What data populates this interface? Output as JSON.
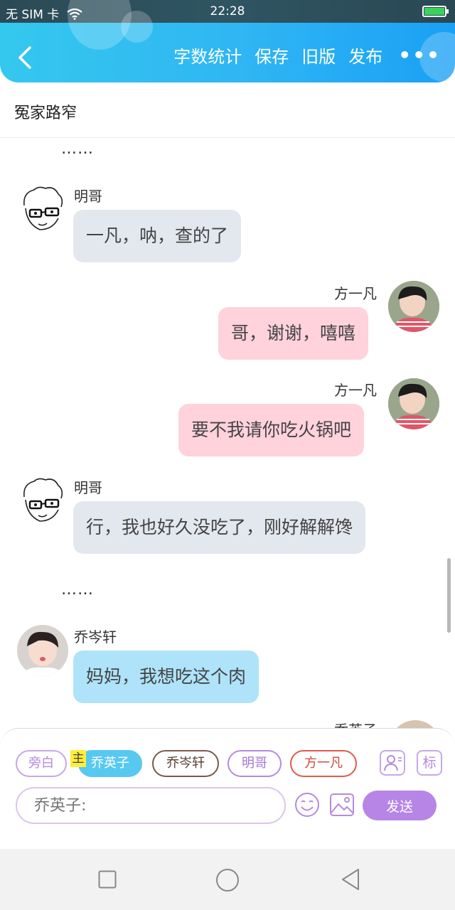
{
  "status_bar": {
    "carrier": "无 SIM 卡",
    "time": "22:28"
  },
  "header": {
    "actions": [
      "字数统计",
      "保存",
      "旧版",
      "发布"
    ],
    "more": "•••"
  },
  "title": "冤家路窄",
  "messages": [
    {
      "type": "ellipsis",
      "text": "……"
    },
    {
      "name": "明哥",
      "text": "一凡，呐，查的了",
      "side": "left",
      "color": "gray"
    },
    {
      "name": "方一凡",
      "text": "哥，谢谢，嘻嘻",
      "side": "right",
      "color": "pink"
    },
    {
      "name": "方一凡",
      "text": "要不我请你吃火锅吧",
      "side": "right",
      "color": "pink"
    },
    {
      "name": "明哥",
      "text": "行，我也好久没吃了，刚好解解馋",
      "side": "left",
      "color": "gray"
    },
    {
      "type": "ellipsis",
      "text": "……"
    },
    {
      "name": "乔岑轩",
      "text": "妈妈，我想吃这个肉",
      "side": "left",
      "color": "blue"
    },
    {
      "name": "乔英子",
      "side": "right",
      "partial": true
    }
  ],
  "characters": [
    {
      "label": "旁白",
      "color": "#c7a8e8",
      "text_color": "#b68ae0"
    },
    {
      "label": "乔英子",
      "active": true
    },
    {
      "label": "乔岑轩",
      "color": "#7a5a4a",
      "text_color": "#5a4034"
    },
    {
      "label": "明哥",
      "color": "#b68ae0",
      "text_color": "#a176d6"
    },
    {
      "label": "方一凡",
      "color": "#e05a4a",
      "text_color": "#d04a3a"
    }
  ],
  "main_tag": "主",
  "mark_label": "标",
  "input": {
    "placeholder": "乔英子:"
  },
  "send_label": "发送",
  "colors": {
    "header": "#2fb5f3",
    "pink_bubble": "#ffd2dc",
    "gray_bubble": "#e3e7ee",
    "blue_bubble": "#aee3fa",
    "send": "#b685e6"
  }
}
